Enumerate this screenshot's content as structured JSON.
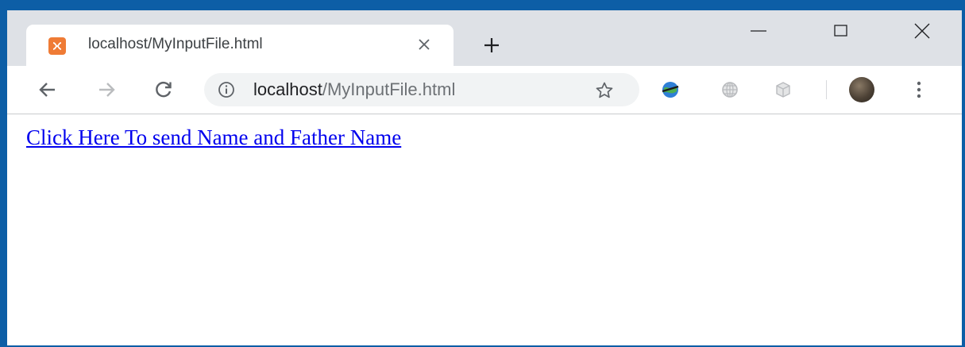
{
  "tab": {
    "title": "localhost/MyInputFile.html"
  },
  "address_bar": {
    "host": "localhost",
    "path": "/MyInputFile.html"
  },
  "page": {
    "link_text": "Click Here To send Name and Father Name"
  },
  "icons": {
    "favicon": "xampp-icon",
    "tab_close": "close-icon",
    "new_tab": "plus-icon",
    "minimize": "minimize-icon",
    "maximize": "maximize-icon",
    "window_close": "close-icon",
    "back": "arrow-left-icon",
    "forward": "arrow-right-icon",
    "reload": "reload-icon",
    "site_info": "info-icon",
    "bookmark": "star-icon",
    "extension_1": "idm-extension-icon",
    "extension_2": "globe-extension-icon",
    "extension_3": "cube-extension-icon",
    "profile": "avatar",
    "menu": "kebab-menu-icon"
  },
  "colors": {
    "window_frame": "#0d5ea6",
    "tabstrip": "#dee1e6",
    "omnibox": "#f1f3f4",
    "link": "#0000ee",
    "favicon": "#ef7b35"
  }
}
